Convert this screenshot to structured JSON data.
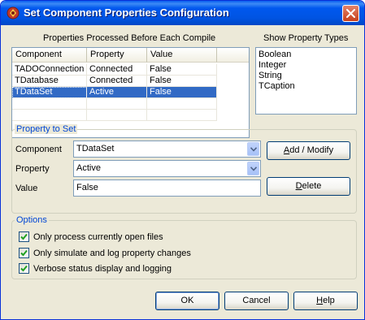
{
  "window": {
    "title": "Set Component Properties Configuration"
  },
  "properties_grid": {
    "caption": "Properties Processed Before Each Compile",
    "columns": [
      "Component",
      "Property",
      "Value"
    ],
    "rows": [
      [
        "TADOConnection",
        "Connected",
        "False"
      ],
      [
        "TDatabase",
        "Connected",
        "False"
      ],
      [
        "TDataSet",
        "Active",
        "False"
      ]
    ],
    "selected_row": 2
  },
  "property_types": {
    "caption": "Show Property Types",
    "items": [
      "Boolean",
      "Integer",
      "String",
      "TCaption"
    ]
  },
  "property_to_set": {
    "legend": "Property to Set",
    "component_label": "Component",
    "component_value": "TDataSet",
    "property_label": "Property",
    "property_value": "Active",
    "value_label": "Value",
    "value_value": "False",
    "add_modify_pre": "",
    "add_modify_u": "A",
    "add_modify_post": "dd / Modify",
    "delete_pre": "",
    "delete_u": "D",
    "delete_post": "elete"
  },
  "options": {
    "legend": "Options",
    "items": [
      {
        "label": "Only process currently open files",
        "checked": true
      },
      {
        "label": "Only simulate and log property changes",
        "checked": true
      },
      {
        "label": "Verbose status display and logging",
        "checked": true
      }
    ]
  },
  "buttons": {
    "ok": "OK",
    "cancel": "Cancel",
    "help_u": "H",
    "help_post": "elp"
  },
  "colors": {
    "titlebar": "#0054e3",
    "selection": "#316ac5",
    "group_label": "#0046d5",
    "dialog_bg": "#ece9d8"
  }
}
